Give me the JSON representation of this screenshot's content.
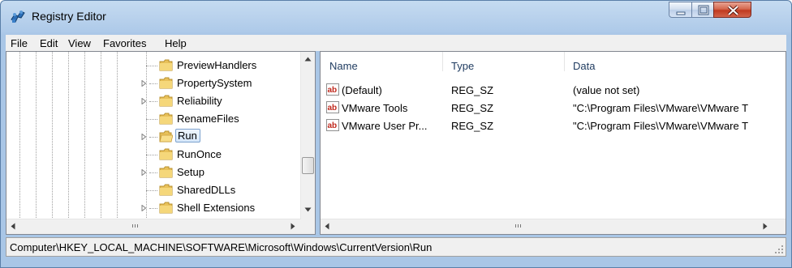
{
  "window": {
    "title": "Registry Editor"
  },
  "menu": [
    "File",
    "Edit",
    "View",
    "Favorites",
    "Help"
  ],
  "tree": {
    "items": [
      {
        "label": "PreviewHandlers",
        "expandable": false,
        "selected": false
      },
      {
        "label": "PropertySystem",
        "expandable": true,
        "selected": false
      },
      {
        "label": "Reliability",
        "expandable": true,
        "selected": false
      },
      {
        "label": "RenameFiles",
        "expandable": false,
        "selected": false
      },
      {
        "label": "Run",
        "expandable": true,
        "selected": true
      },
      {
        "label": "RunOnce",
        "expandable": false,
        "selected": false
      },
      {
        "label": "Setup",
        "expandable": true,
        "selected": false
      },
      {
        "label": "SharedDLLs",
        "expandable": false,
        "selected": false
      },
      {
        "label": "Shell Extensions",
        "expandable": true,
        "selected": false
      }
    ]
  },
  "list": {
    "columns": [
      "Name",
      "Type",
      "Data"
    ],
    "rows": [
      {
        "name": "(Default)",
        "type": "REG_SZ",
        "data": "(value not set)"
      },
      {
        "name": "VMware Tools",
        "type": "REG_SZ",
        "data": "\"C:\\Program Files\\VMware\\VMware T"
      },
      {
        "name": "VMware User Pr...",
        "type": "REG_SZ",
        "data": "\"C:\\Program Files\\VMware\\VMware T"
      }
    ]
  },
  "status": {
    "path": "Computer\\HKEY_LOCAL_MACHINE\\SOFTWARE\\Microsoft\\Windows\\CurrentVersion\\Run"
  },
  "icons": {
    "app": "registry-editor-icon",
    "folder": "folder-icon",
    "value": "string-value-icon"
  },
  "colors": {
    "titlebar": "#b8d1ec",
    "selection": "#d6e7fa",
    "close": "#c0391f"
  }
}
